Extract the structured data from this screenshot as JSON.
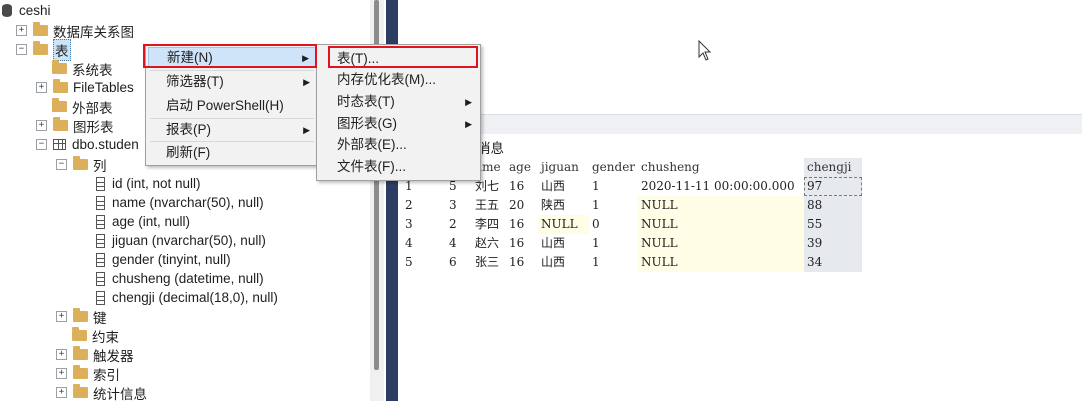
{
  "explorer": {
    "database": "ceshi",
    "db_diagrams": "数据库关系图",
    "tables": "表",
    "system_tables": "系统表",
    "filetables": "FileTables",
    "external_tables": "外部表",
    "graph_tables": "图形表",
    "table_name": "dbo.studen",
    "columns_folder": "列",
    "columns": [
      "id (int, not null)",
      "name (nvarchar(50), null)",
      "age (int, null)",
      "jiguan (nvarchar(50), null)",
      "gender (tinyint, null)",
      "chusheng (datetime, null)",
      "chengji (decimal(18,0), null)"
    ],
    "keys": "键",
    "constraints": "约束",
    "triggers": "触发器",
    "indexes": "索引",
    "statistics": "统计信息",
    "expand_plus": "+",
    "expand_minus": "−"
  },
  "context_menu": {
    "items": [
      {
        "label": "新建(N)",
        "arrow": "▶"
      },
      {
        "label": "筛选器(T)",
        "arrow": "▶"
      },
      {
        "label": "启动 PowerShell(H)",
        "arrow": ""
      },
      {
        "label": "报表(P)",
        "arrow": "▶"
      },
      {
        "label": "刷新(F)",
        "arrow": ""
      }
    ]
  },
  "submenu": {
    "items": [
      {
        "label": "表(T)...",
        "arrow": ""
      },
      {
        "label": "内存优化表(M)...",
        "arrow": ""
      },
      {
        "label": "时态表(T)",
        "arrow": "▶"
      },
      {
        "label": "图形表(G)",
        "arrow": "▶"
      },
      {
        "label": "外部表(E)...",
        "arrow": ""
      },
      {
        "label": "文件表(F)...",
        "arrow": ""
      }
    ]
  },
  "results": {
    "tab_messages": "消息",
    "columns": [
      "ame",
      "age",
      "jiguan",
      "gender",
      "chusheng",
      "chengji"
    ],
    "rows": [
      {
        "rownum": "1",
        "id": "5",
        "name": "刘七",
        "age": "16",
        "jiguan": "山西",
        "gender": "1",
        "chusheng": "2020-11-11 00:00:00.000",
        "chengji": "97"
      },
      {
        "rownum": "2",
        "id": "3",
        "name": "王五",
        "age": "20",
        "jiguan": "陕西",
        "gender": "1",
        "chusheng": "NULL",
        "chengji": "88"
      },
      {
        "rownum": "3",
        "id": "2",
        "name": "李四",
        "age": "16",
        "jiguan": "NULL",
        "gender": "0",
        "chusheng": "NULL",
        "chengji": "55"
      },
      {
        "rownum": "4",
        "id": "4",
        "name": "赵六",
        "age": "16",
        "jiguan": "山西",
        "gender": "1",
        "chusheng": "NULL",
        "chengji": "39"
      },
      {
        "rownum": "5",
        "id": "6",
        "name": "张三",
        "age": "16",
        "jiguan": "山西",
        "gender": "1",
        "chusheng": "NULL",
        "chengji": "34"
      }
    ]
  },
  "colors": {
    "divider": "#2b3d63",
    "highlight_box": "#e0141e",
    "menu_hover": "#cfe3f9",
    "null_cell": "#fffde6",
    "folder": "#dcb05a"
  }
}
